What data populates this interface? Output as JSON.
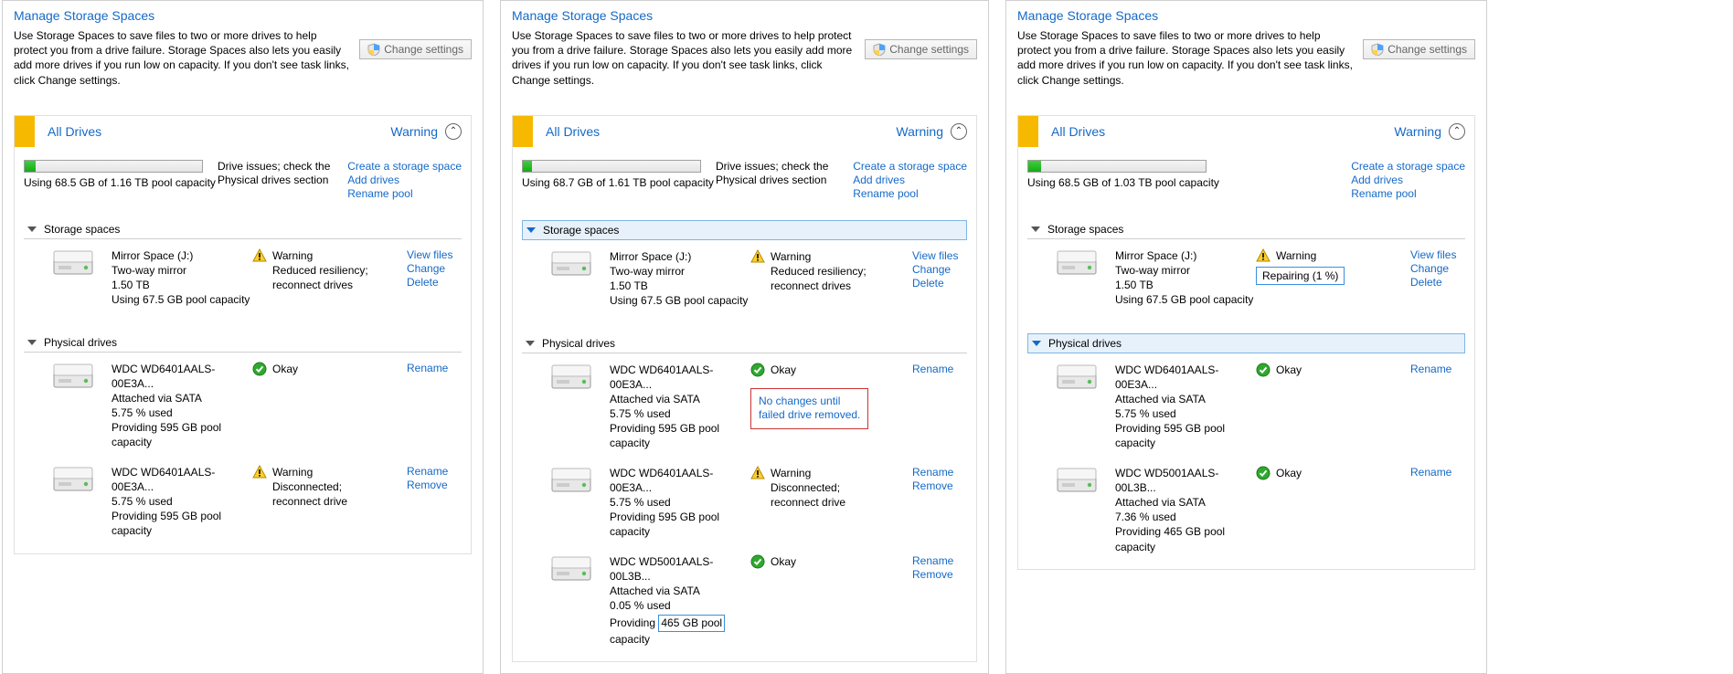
{
  "common": {
    "page_title": "Manage Storage Spaces",
    "intro": "Use Storage Spaces to save files to two or more drives to help protect you from a drive failure. Storage Spaces also lets you easily add more drives if you run low on capacity. If you don't see task links, click Change settings.",
    "change_settings": "Change settings",
    "pool_name": "All Drives",
    "warning": "Warning",
    "create_space": "Create a storage space",
    "add_drives": "Add drives",
    "rename_pool": "Rename pool",
    "storage_spaces": "Storage spaces",
    "physical_drives": "Physical drives",
    "view_files": "View files",
    "change": "Change",
    "delete": "Delete",
    "rename": "Rename",
    "remove": "Remove",
    "okay": "Okay",
    "warn_label": "Warning",
    "drive_issues": "Drive issues; check the Physical drives section",
    "mirror_name": "Mirror Space (J:)",
    "mirror_type": "Two-way mirror",
    "mirror_size": "1.50 TB",
    "mirror_usage": "Using 67.5 GB pool capacity",
    "reduced": "Reduced resiliency; reconnect drives",
    "wd6401": "WDC WD6401AALS-00E3A...",
    "wd5001": "WDC WD5001AALS-00L3B...",
    "attached_sata": "Attached via SATA",
    "disconnected": "Disconnected; reconnect drive"
  },
  "p1": {
    "meter_text": "Using 68.5 GB of 1.16 TB pool capacity",
    "drives": {
      "d0": {
        "used": "5.75 % used",
        "provide": "Providing 595 GB pool capacity"
      },
      "d1": {
        "used": "5.75 % used",
        "provide": "Providing 595 GB pool capacity"
      }
    }
  },
  "p2": {
    "meter_text": "Using 68.7 GB of 1.61 TB pool capacity",
    "annot_l1": "No changes until",
    "annot_l2": "failed drive removed.",
    "drives": {
      "d0": {
        "used": "5.75 % used",
        "provide": "Providing 595 GB pool capacity"
      },
      "d1": {
        "used": "5.75 % used",
        "provide": "Providing 595 GB pool capacity"
      },
      "d2": {
        "used": "0.05 % used",
        "provide_a": "Providing ",
        "provide_b": "465 GB pool",
        "provide_c": "capacity"
      }
    }
  },
  "p3": {
    "meter_text": "Using 68.5 GB of 1.03 TB pool capacity",
    "repairing": "Repairing (1 %)",
    "drives": {
      "d0": {
        "used": "5.75 % used",
        "provide": "Providing 595 GB pool capacity"
      },
      "d1": {
        "used": "7.36 % used",
        "provide": "Providing 465 GB pool capacity"
      }
    }
  }
}
